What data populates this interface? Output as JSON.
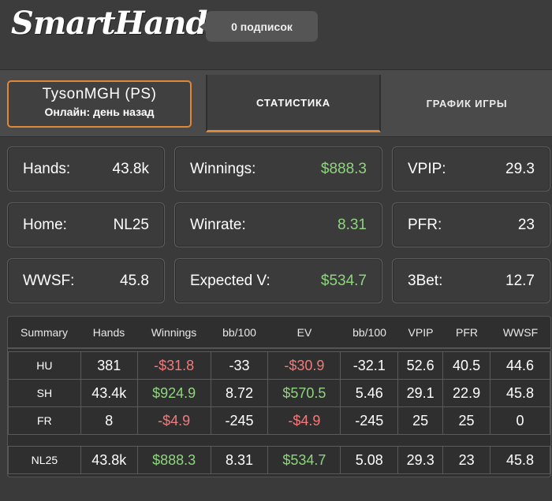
{
  "header": {
    "logo": "SmartHand",
    "subscribers": "0 подписок"
  },
  "player": {
    "name": "TysonMGH (PS)",
    "status": "Онлайн: день назад"
  },
  "tabs": {
    "stats": "СТАТИСТИКА",
    "graph": "ГРАФИК ИГРЫ"
  },
  "stats": {
    "hands": {
      "label": "Hands:",
      "value": "43.8k"
    },
    "winnings": {
      "label": "Winnings:",
      "value": "$888.3"
    },
    "vpip": {
      "label": "VPIP:",
      "value": "29.3"
    },
    "home": {
      "label": "Home:",
      "value": "NL25"
    },
    "winrate": {
      "label": "Winrate:",
      "value": "8.31"
    },
    "pfr": {
      "label": "PFR:",
      "value": "23"
    },
    "wwsf": {
      "label": "WWSF:",
      "value": "45.8"
    },
    "expected": {
      "label": "Expected V:",
      "value": "$534.7"
    },
    "threebet": {
      "label": "3Bet:",
      "value": "12.7"
    }
  },
  "table": {
    "headers": [
      "Summary",
      "Hands",
      "Winnings",
      "bb/100",
      "EV",
      "bb/100",
      "VPIP",
      "PFR",
      "WWSF"
    ],
    "rows": [
      [
        "HU",
        "381",
        "-$31.8",
        "-33",
        "-$30.9",
        "-32.1",
        "52.6",
        "40.5",
        "44.6"
      ],
      [
        "SH",
        "43.4k",
        "$924.9",
        "8.72",
        "$570.5",
        "5.46",
        "29.1",
        "22.9",
        "45.8"
      ],
      [
        "FR",
        "8",
        "-$4.9",
        "-245",
        "-$4.9",
        "-245",
        "25",
        "25",
        "0"
      ]
    ],
    "total": [
      "NL25",
      "43.8k",
      "$888.3",
      "8.31",
      "$534.7",
      "5.08",
      "29.3",
      "23",
      "45.8"
    ]
  },
  "colors": {
    "accent": "#e0883a",
    "positive": "#8fd47e",
    "negative": "#ef7b7b"
  }
}
